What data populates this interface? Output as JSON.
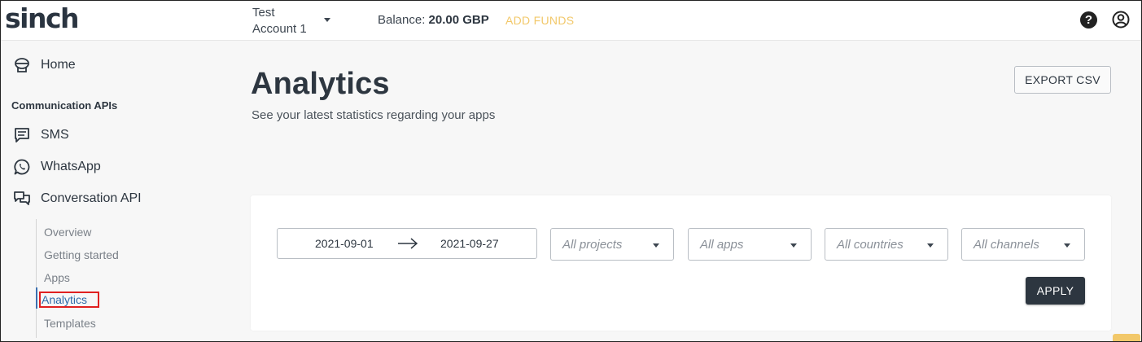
{
  "header": {
    "logo": "sinch",
    "account": "Test Account 1",
    "balance_label": "Balance:",
    "balance_value": "20.00 GBP",
    "add_funds": "ADD FUNDS"
  },
  "sidebar": {
    "home": "Home",
    "section_title": "Communication APIs",
    "items": [
      {
        "label": "SMS",
        "icon": "chat-lines-icon"
      },
      {
        "label": "WhatsApp",
        "icon": "whatsapp-icon"
      },
      {
        "label": "Conversation API",
        "icon": "conversation-icon"
      }
    ],
    "subitems": [
      "Overview",
      "Getting started",
      "Apps",
      "Analytics",
      "Templates"
    ],
    "active_subitem": "Analytics"
  },
  "main": {
    "title": "Analytics",
    "subtitle": "See your latest statistics regarding your apps",
    "export_label": "EXPORT CSV",
    "filters": {
      "date_start": "2021-09-01",
      "date_end": "2021-09-27",
      "projects": "All projects",
      "apps": "All apps",
      "countries": "All countries",
      "channels": "All channels"
    },
    "apply_label": "APPLY"
  },
  "colors": {
    "accent": "#f2c86a",
    "dark": "#2d3640",
    "link": "#2f6aa8",
    "highlight": "#e02020"
  }
}
